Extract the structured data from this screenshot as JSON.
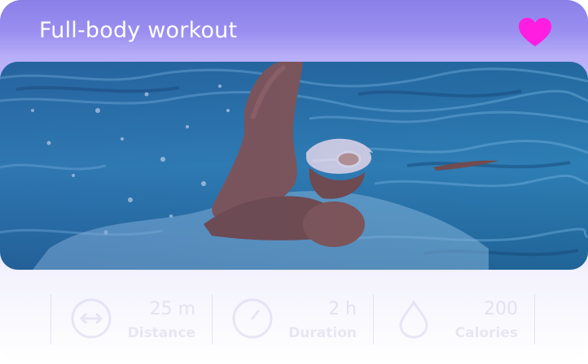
{
  "header": {
    "title": "Full-body workout",
    "favorite_color": "#ff1ee0"
  },
  "photo": {
    "subject": "swimmer"
  },
  "stats": [
    {
      "icon": "distance-arrows-icon",
      "value": "25 m",
      "label": "Distance"
    },
    {
      "icon": "stopwatch-icon",
      "value": "2 h",
      "label": "Duration"
    },
    {
      "icon": "drop-icon",
      "value": "200",
      "label": "Calories"
    }
  ],
  "colors": {
    "accent": "#8a80e8",
    "water": "#2f86b5"
  }
}
